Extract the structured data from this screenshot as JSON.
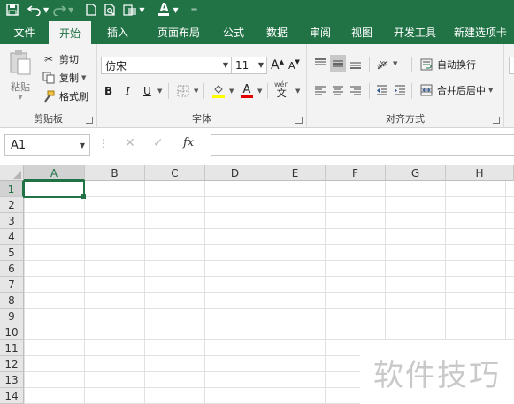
{
  "quick_access": {
    "save_icon": "save-icon",
    "undo_icon": "undo-icon",
    "redo_icon": "redo-icon",
    "new_icon": "new-file-icon",
    "preview_icon": "print-preview-icon",
    "import_icon": "import-icon",
    "font_color_icon": "font-color-icon",
    "customize_icon": "customize-icon"
  },
  "tabs": [
    "文件",
    "开始",
    "插入",
    "页面布局",
    "公式",
    "数据",
    "审阅",
    "视图",
    "开发工具",
    "新建选项卡"
  ],
  "active_tab": "开始",
  "clipboard": {
    "paste": "粘贴",
    "cut": "剪切",
    "copy": "复制",
    "format_painter": "格式刷",
    "label": "剪贴板"
  },
  "font": {
    "name": "仿宋",
    "size": "11",
    "grow": "A",
    "shrink": "A",
    "bold": "B",
    "italic": "I",
    "underline": "U",
    "label": "字体",
    "wen": "wén"
  },
  "alignment": {
    "wrap_text": "自动换行",
    "merge_center": "合并后居中",
    "label": "对齐方式"
  },
  "formula_bar": {
    "name_box": "A1",
    "fx": "fx",
    "value": ""
  },
  "grid": {
    "columns": [
      "A",
      "B",
      "C",
      "D",
      "E",
      "F",
      "G",
      "H"
    ],
    "rows": [
      "1",
      "2",
      "3",
      "4",
      "5",
      "6",
      "7",
      "8",
      "9",
      "10",
      "11",
      "12",
      "13",
      "14"
    ],
    "active_cell": "A1"
  },
  "watermark": "软件技巧",
  "colors": {
    "accent": "#217346",
    "ribbon_bg": "#f3f3f3",
    "header_bg": "#e6e6e6"
  }
}
